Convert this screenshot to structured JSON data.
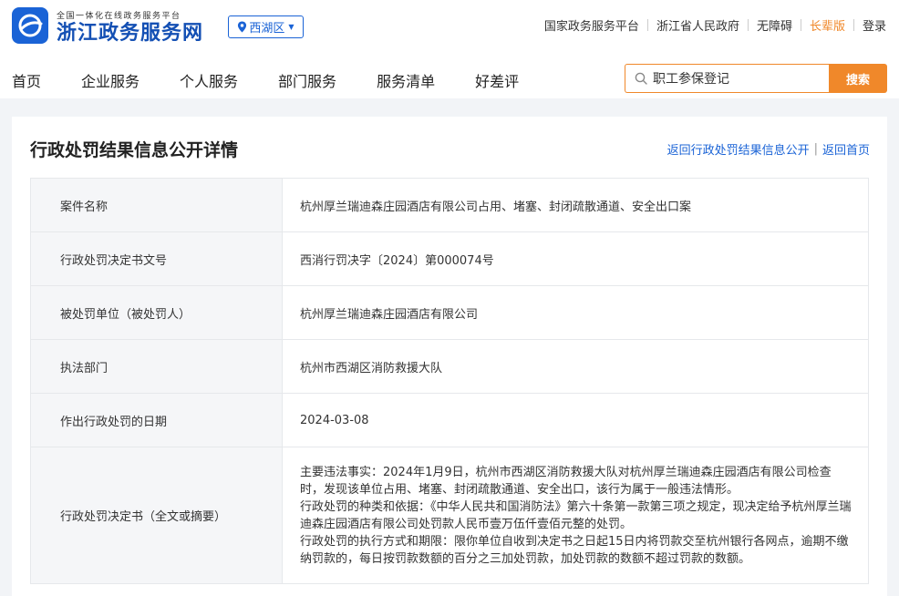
{
  "header": {
    "brand_sub": "全国一体化在线政务服务平台",
    "brand_main": "浙江政务服务网",
    "region": "西湖区",
    "top_links": [
      "国家政务服务平台",
      "浙江省人民政府",
      "无障碍",
      "长辈版",
      "登录"
    ],
    "accent_color": "#1a63d6",
    "orange_color": "#f0882a"
  },
  "nav": {
    "items": [
      "首页",
      "企业服务",
      "个人服务",
      "部门服务",
      "服务清单",
      "好差评"
    ]
  },
  "search": {
    "value": "职工参保登记",
    "button_label": "搜索"
  },
  "panel": {
    "title": "行政处罚结果信息公开详情",
    "back_list_link": "返回行政处罚结果信息公开",
    "separator": "|",
    "back_home_link": "返回首页"
  },
  "detail": {
    "rows": [
      {
        "key": "案件名称",
        "value": "杭州厚兰瑞迪森庄园酒店有限公司占用、堵塞、封闭疏散通道、安全出口案"
      },
      {
        "key": "行政处罚决定书文号",
        "value": "西消行罚决字〔2024〕第000074号"
      },
      {
        "key": "被处罚单位（被处罚人）",
        "value": "杭州厚兰瑞迪森庄园酒店有限公司"
      },
      {
        "key": "执法部门",
        "value": "杭州市西湖区消防救援大队"
      },
      {
        "key": "作出行政处罚的日期",
        "value": "2024-03-08"
      }
    ],
    "decision_key": "行政处罚决定书（全文或摘要）",
    "decision_paragraphs": [
      "主要违法事实：2024年1月9日，杭州市西湖区消防救援大队对杭州厚兰瑞迪森庄园酒店有限公司检查时，发现该单位占用、堵塞、封闭疏散通道、安全出口，该行为属于一般违法情形。",
      "行政处罚的种类和依据：《中华人民共和国消防法》第六十条第一款第三项之规定，现决定给予杭州厚兰瑞迪森庄园酒店有限公司处罚款人民币壹万伍仟壹佰元整的处罚。",
      "行政处罚的执行方式和期限：限你单位自收到决定书之日起15日内将罚款交至杭州银行各网点，逾期不缴纳罚款的，每日按罚款数额的百分之三加处罚款，加处罚款的数额不超过罚款的数额。"
    ]
  }
}
